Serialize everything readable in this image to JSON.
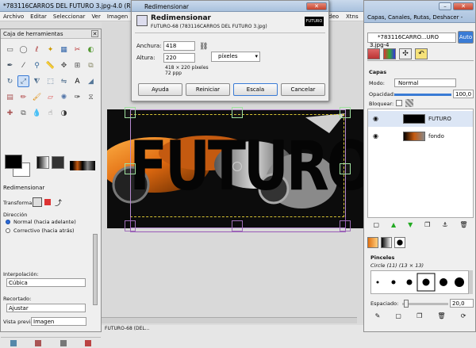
{
  "main_window": {
    "title": "*783116CARROS DEL FUTURO 3.jpg-4.0 (RG",
    "menu": [
      "Archivo",
      "Editar",
      "Seleccionar",
      "Ver",
      "Imagen",
      "deo",
      "Xtns"
    ],
    "image_text": "FUTURO"
  },
  "toolbox": {
    "title": "Caja de herramientas",
    "tools": [
      "rect-select-icon",
      "ellipse-select-icon",
      "lasso-icon",
      "fuzzy-select-icon",
      "color-select-icon",
      "scissors-icon",
      "foreground-select-icon",
      "paths-icon",
      "color-picker-icon",
      "zoom-icon",
      "measure-icon",
      "move-icon",
      "align-icon",
      "crop-icon",
      "rotate-icon",
      "scale-icon",
      "shear-icon",
      "perspective-icon",
      "flip-icon",
      "text-icon",
      "bucket-fill-icon",
      "blend-icon",
      "pencil-icon",
      "paintbrush-icon",
      "eraser-icon",
      "airbrush-icon",
      "ink-icon",
      "clone-icon",
      "heal-icon",
      "perspective-clone-icon",
      "blur-icon",
      "smudge-icon",
      "dodge-icon"
    ]
  },
  "tool_options": {
    "title": "Redimensionar",
    "transform_label": "Transformar:",
    "direction_label": "Dirección",
    "direction_normal": "Normal (hacia adelante)",
    "direction_corrective": "Correctivo (hacia atrás)",
    "interpolation_label": "Interpolación:",
    "interpolation_value": "Cúbica",
    "clipping_label": "Recortado:",
    "clipping_value": "Ajustar",
    "preview_label": "Vista previa:",
    "preview_value": "Imagen"
  },
  "scale_dialog": {
    "title": "Redimensionar",
    "subtitle": "Redimensionar",
    "filename": "FUTURO-68 (783116CARROS DEL FUTURO 3.jpg)",
    "width_label": "Anchura:",
    "width_value": "418",
    "height_label": "Altura:",
    "height_value": "220",
    "unit": "píxeles",
    "size_info": "418 × 220 píxeles",
    "resolution": "72 ppp",
    "buttons": {
      "help": "Ayuda",
      "reset": "Reiniciar",
      "scale": "Escala",
      "cancel": "Cancelar"
    }
  },
  "layers_panel": {
    "title": "Capas, Canales, Rutas, Deshacer -",
    "image_selector": "*783116CARRO...URO 3.jpg-4",
    "auto_label": "Auto",
    "section": "Capas",
    "mode_label": "Modo:",
    "mode_value": "Normal",
    "opacity_label": "Opacidad:",
    "opacity_value": "100,0",
    "lock_label": "Bloquear:",
    "layers": [
      {
        "name": "FUTURO"
      },
      {
        "name": "fondo"
      }
    ]
  },
  "brushes_panel": {
    "title": "Pinceles",
    "brush_name": "Circle (11) (13 × 13)",
    "spacing_label": "Espaciado:",
    "spacing_value": "20,0"
  },
  "status_bar": {
    "text": "FUTURO-68 (DEL..."
  }
}
